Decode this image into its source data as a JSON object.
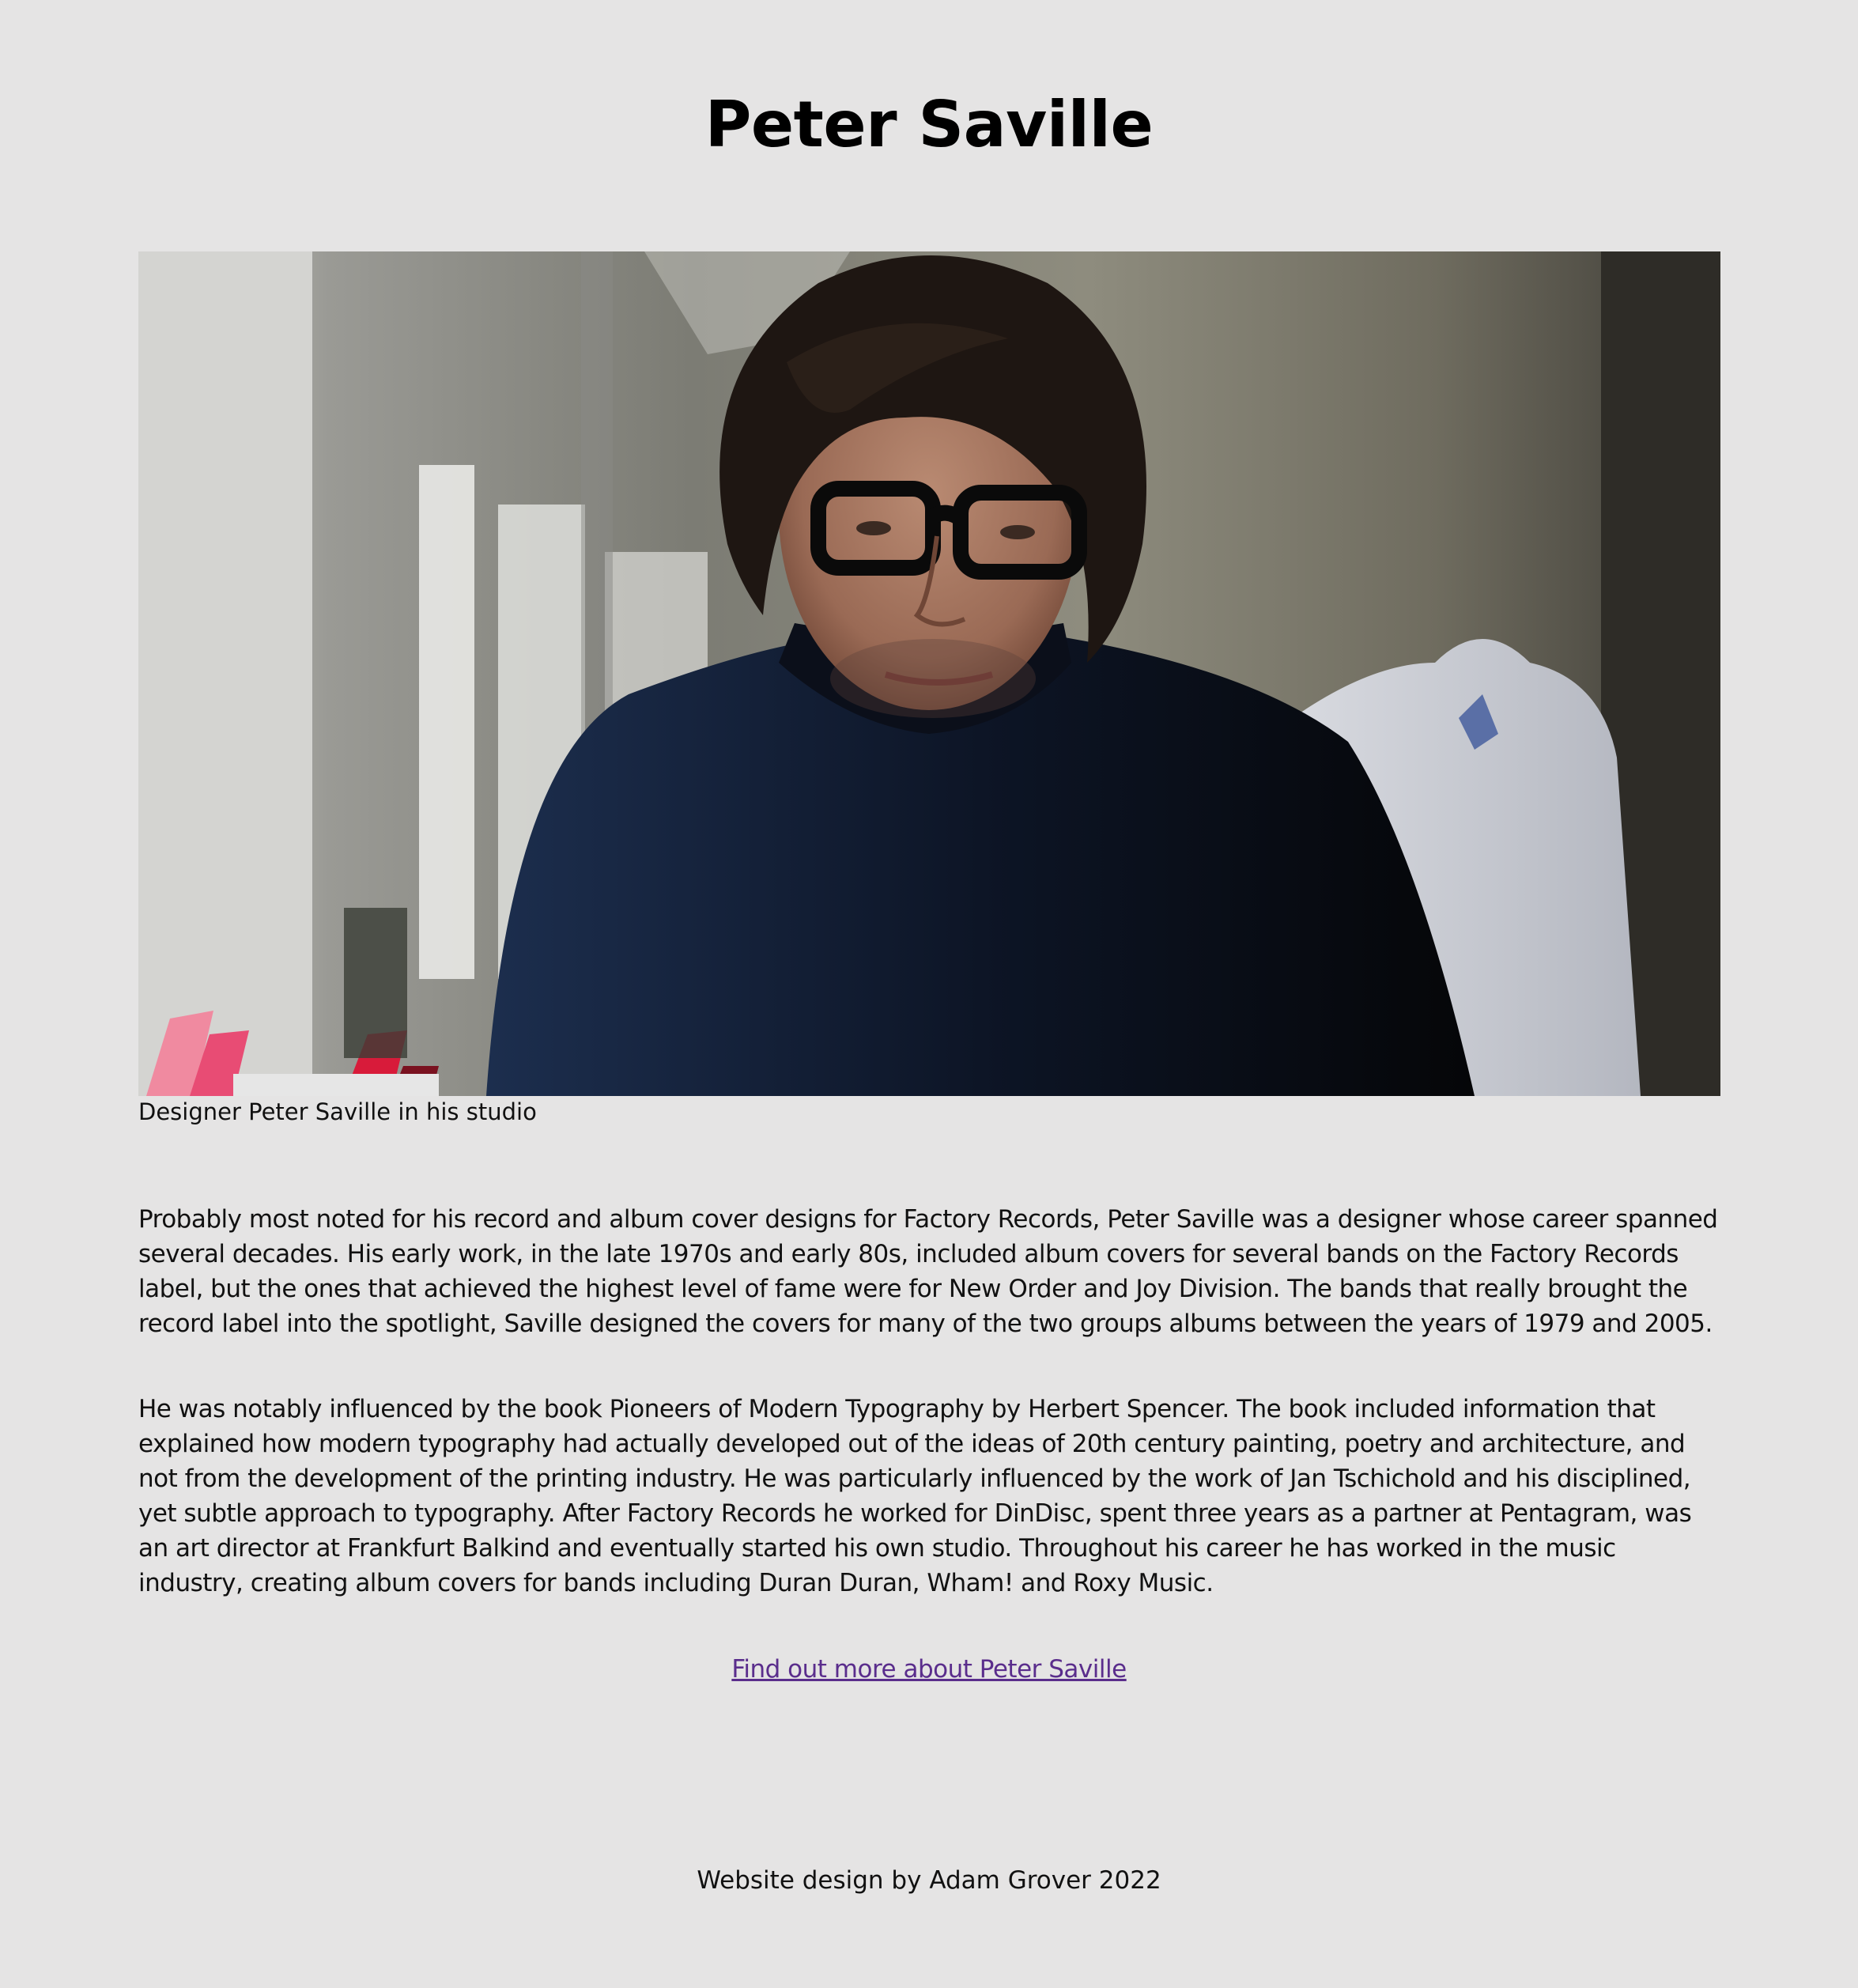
{
  "header": {
    "title": "Peter Saville"
  },
  "hero": {
    "caption": "Designer Peter Saville in his studio",
    "image_alt": "Portrait of Peter Saville wearing black glasses and a dark navy roll-neck sweater in his studio"
  },
  "article": {
    "paragraphs": [
      "Probably most noted for his record and album cover designs for Factory Records, Peter Saville was a designer whose career spanned several decades. His early work, in the late 1970s and early 80s, included album covers for several bands on the Factory Records label, but the ones that achieved the highest level of fame were for New Order and Joy Division. The bands that really brought the record label into the spotlight, Saville designed the covers for many of the two groups albums between the years of 1979 and 2005.",
      "He was notably influenced by the book Pioneers of Modern Typography by Herbert Spencer. The book included information that explained how modern typography had actually developed out of the ideas of 20th century painting, poetry and architecture, and not from the development of the printing industry. He was particularly influenced by the work of Jan Tschichold and his disciplined, yet subtle approach to typography. After Factory Records he worked for DinDisc, spent three years as a partner at Pentagram, was an art director at Frankfurt Balkind and eventually started his own studio. Throughout his career he has worked in the music industry, creating album covers for bands including Duran Duran, Wham! and Roxy Music."
    ],
    "more_link": "Find out more about Peter Saville"
  },
  "footer": {
    "credit": "Website design by Adam Grover 2022"
  },
  "colors": {
    "background": "#e5e4e4",
    "text": "#111111",
    "link": "#5a2d8c"
  }
}
